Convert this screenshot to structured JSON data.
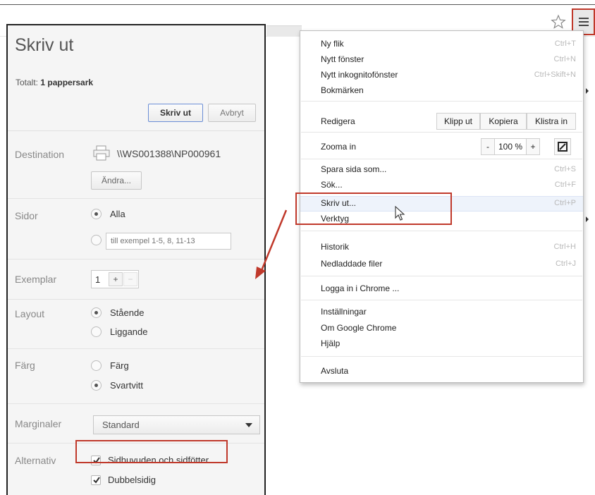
{
  "print_panel": {
    "title": "Skriv ut",
    "total_prefix": "Totalt:",
    "total_value": "1 pappersark",
    "print_button": "Skriv ut",
    "cancel_button": "Avbryt",
    "destination": {
      "label": "Destination",
      "printer": "\\\\WS001388\\NP000961",
      "change_button": "Ändra..."
    },
    "pages": {
      "label": "Sidor",
      "all_option": "Alla",
      "range_placeholder": "till exempel 1-5, 8, 11-13"
    },
    "copies": {
      "label": "Exemplar",
      "value": "1",
      "plus": "+",
      "minus": "−"
    },
    "layout": {
      "label": "Layout",
      "portrait": "Stående",
      "landscape": "Liggande"
    },
    "color": {
      "label": "Färg",
      "color_option": "Färg",
      "bw_option": "Svartvitt"
    },
    "margins": {
      "label": "Marginaler",
      "value": "Standard"
    },
    "options": {
      "label": "Alternativ",
      "headers_footers": "Sidhuvuden och sidfötter",
      "duplex": "Dubbelsidig"
    }
  },
  "chrome_menu": {
    "new_tab": "Ny flik",
    "new_tab_shortcut": "Ctrl+T",
    "new_window": "Nytt fönster",
    "new_window_shortcut": "Ctrl+N",
    "incognito": "Nytt inkognitofönster",
    "incognito_shortcut": "Ctrl+Skift+N",
    "bookmarks": "Bokmärken",
    "edit": "Redigera",
    "cut": "Klipp ut",
    "copy": "Kopiera",
    "paste": "Klistra in",
    "zoom": "Zooma in",
    "zoom_minus": "-",
    "zoom_value": "100 %",
    "zoom_plus": "+",
    "save_page": "Spara sida som...",
    "save_page_shortcut": "Ctrl+S",
    "find": "Sök...",
    "find_shortcut": "Ctrl+F",
    "print": "Skriv ut...",
    "print_shortcut": "Ctrl+P",
    "tools": "Verktyg",
    "history": "Historik",
    "history_shortcut": "Ctrl+H",
    "downloads": "Nedladdade filer",
    "downloads_shortcut": "Ctrl+J",
    "sign_in": "Logga in i Chrome ...",
    "settings": "Inställningar",
    "about": "Om Google Chrome",
    "help": "Hjälp",
    "exit": "Avsluta"
  },
  "colors": {
    "highlight": "#c0392b",
    "panel_bg": "#f5f5f5",
    "menu_bg": "#ffffff"
  },
  "icons": [
    "star-icon",
    "hamburger-menu-icon",
    "printer-icon",
    "cursor-icon",
    "arrow-annotation"
  ]
}
